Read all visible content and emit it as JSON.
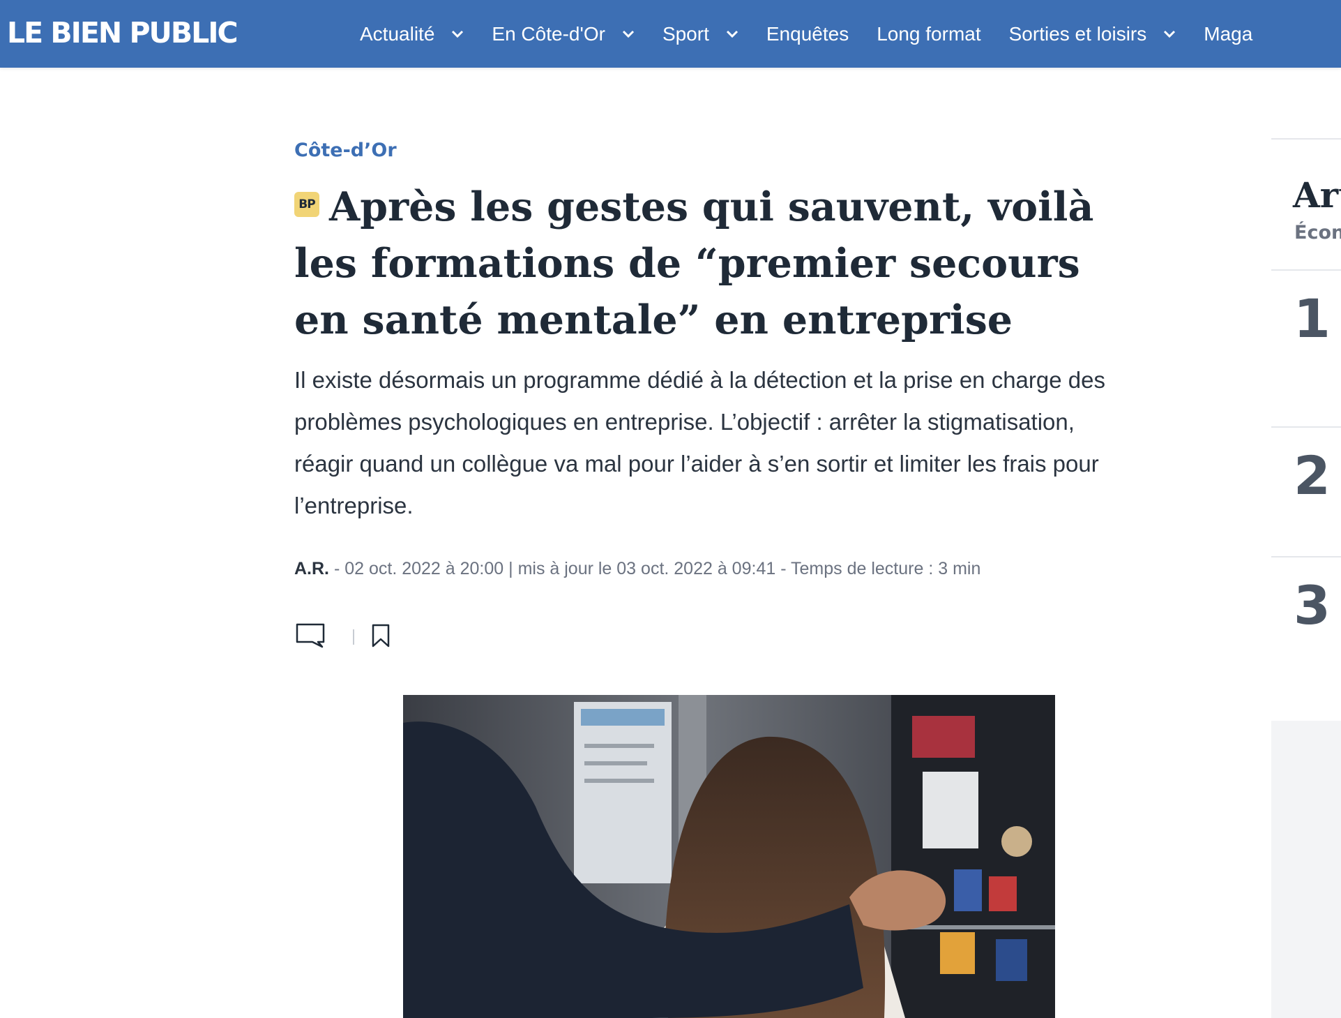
{
  "header": {
    "logo": "LE BIEN PUBLIC",
    "nav": [
      {
        "label": "Actualité",
        "has_dropdown": true
      },
      {
        "label": "En Côte-d'Or",
        "has_dropdown": true
      },
      {
        "label": "Sport",
        "has_dropdown": true
      },
      {
        "label": "Enquêtes",
        "has_dropdown": false
      },
      {
        "label": "Long format",
        "has_dropdown": false
      },
      {
        "label": "Sorties et loisirs",
        "has_dropdown": true
      },
      {
        "label": "Maga",
        "has_dropdown": false
      }
    ]
  },
  "article": {
    "category": "Côte-d’Or",
    "badge": "BP",
    "title": "Après les gestes qui sauvent, voilà les formations de “premier secours en santé mentale” en entreprise",
    "chapo": "Il existe désormais un programme dédié à la détection et la prise en charge des problèmes psychologiques en entreprise. L’objectif : arrêter la stigmatisation, réagir quand un collègue va mal pour l’aider à s’en sortir et limiter les frais pour l’entreprise.",
    "meta": {
      "author": "A.R.",
      "details": " - 02 oct. 2022 à 20:00 | mis à jour le 03 oct. 2022 à 09:41 - Temps de lecture : 3 min"
    },
    "actions": {
      "comment_icon": "comment-icon",
      "bookmark_icon": "bookmark-icon"
    }
  },
  "sidebar": {
    "title": "Art",
    "subtitle": "Écon",
    "ranks": [
      "1",
      "2",
      "3"
    ]
  },
  "colors": {
    "brand": "#3d6fb4",
    "badge": "#f1d476",
    "text": "#1f2a37",
    "meta": "#6b7280"
  }
}
